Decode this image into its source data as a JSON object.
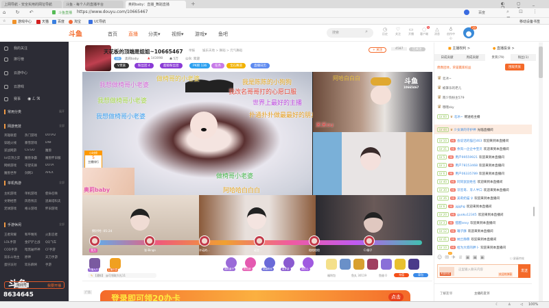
{
  "browser": {
    "tabs": [
      {
        "label": "上网导航 - 安全实用的网址导航"
      },
      {
        "label": "斗鱼 - 每个人的直播平台"
      },
      {
        "label": "奥莉baby：直播_舞蹈直播"
      }
    ],
    "site_label": "斗鱼直播",
    "url": "https://www.douyu.com/10665467",
    "search_engine": "百度",
    "bookmarks": [
      "游戏中心",
      "天猫",
      "百度",
      "淘宝",
      "UC导航"
    ],
    "mobile_bookmarks": "移动设备书签",
    "zoom": "100%"
  },
  "site": {
    "logo": "斗鱼",
    "nav": [
      "首页",
      "直播",
      "分类",
      "视频",
      "游戏",
      "鱼吧"
    ],
    "active_nav": "直播",
    "search_placeholder": "搜索",
    "icons": [
      {
        "label": "历史"
      },
      {
        "label": "关注"
      },
      {
        "label": "开播"
      },
      {
        "label": "客户端",
        "badge": "1"
      },
      {
        "label": "消息"
      },
      {
        "label": "创作中心"
      }
    ],
    "avatar_badge": "20"
  },
  "sidebar": {
    "items": [
      "我的关注",
      "排行榜",
      "云游中心",
      "云游戏",
      "赛事"
    ],
    "common": {
      "title": "常用分类",
      "more": "展开"
    },
    "sections": [
      {
        "title": "网游竞技",
        "more": "全部",
        "games": [
          "英雄联盟",
          "热门游戏",
          "DOTA2",
          "穿越火线",
          "暴雪游戏",
          "DNF",
          "逆战网游",
          "CS:GO",
          "魔兽",
          "lol云顶之弈",
          "魔兽争霸",
          "魔兽怀旧服",
          "网络游戏",
          "守望先锋",
          "DOTA",
          "魔兽世界",
          "剑网3",
          "APEX"
        ]
      },
      {
        "title": "单机热游",
        "more": "全部",
        "games": [
          "主机游戏",
          "单机游戏",
          "使命召唤",
          "文明经营",
          "风卷残云",
          "逃离塔科夫",
          "足球游戏",
          "格斗游戏",
          "怀旧游戏"
        ]
      },
      {
        "title": "手游休闲",
        "more": "全部",
        "games": [
          "王者荣耀",
          "和平精英",
          "火影忍者",
          "LOL手游",
          "金铲铲之战",
          "QQ飞车",
          "COD手游",
          "暗黑破坏神",
          "CF手游",
          "双乐斗地主",
          "原神",
          "天刀手游",
          "蛋仔派对",
          "欢乐麻将",
          "手游"
        ]
      }
    ],
    "room_label": "房间号",
    "room_number": "8634645",
    "start_stream": "我要开播"
  },
  "room": {
    "title": "天花板的顶端是姐姐~10665467",
    "report": "举报",
    "category": "娱乐天地 > 舞蹈 > 元气舞蹈",
    "anchor_level": "34",
    "anchor_name": "奥莉baby",
    "hot": "143098",
    "fans": "5万",
    "announce": "公众: 欢迎",
    "follow": "+ 关注",
    "follow_count": "4587",
    "followed": "已关注",
    "badges": [
      {
        "label": "V贵族",
        "color": "#333"
      },
      {
        "label": "粉丝团 4",
        "color": "#8a3bd6"
      },
      {
        "label": "超级粉丝团",
        "color": "#8a3bd6"
      },
      {
        "label": "PK榜 136",
        "color": "#2ea1f0"
      },
      {
        "label": "任务",
        "color": "#c77ae8"
      },
      {
        "label": "宝石赛道",
        "color": "#f2b200"
      },
      {
        "label": "直播日历",
        "color": "#5d8af0"
      }
    ],
    "hot_tag": "热度榜 1 火爆",
    "share": "分享",
    "client": "客户端"
  },
  "video": {
    "danmaku": [
      {
        "text": "做椅哥的小老婆",
        "color": "#e4c23a"
      },
      {
        "text": "我想做椅哥小老婆",
        "color": "#d86ad8"
      },
      {
        "text": "我想做椅哥小老婆",
        "color": "#a8d84a"
      },
      {
        "text": "我想做椅哥小老婆",
        "color": "#3aa0f0"
      },
      {
        "text": "我是陈陈的小狗狗",
        "color": "#e8a820"
      },
      {
        "text": "我改名哥哥打的心愿口服",
        "color": "#e84a3a"
      },
      {
        "text": "世界上最好的主播",
        "color": "#c04ae0"
      },
      {
        "text": "扑通扑扑做最最好的朋友",
        "color": "#e8a020"
      },
      {
        "text": "做椅哥小老婆",
        "color": "#4ab850"
      },
      {
        "text": "阿哈哈白白白",
        "color": "#e8a820"
      }
    ],
    "main_name": "奥莉baby",
    "rank_label": "小时榜",
    "rank_value": "5",
    "rank_sub": "主播排行",
    "tile_top_right": "阿哈白白白",
    "tile_name": "米米ou",
    "watermark": "斗鱼",
    "watermark_room": "10665467",
    "pk_players": [
      {
        "name": "我方"
      },
      {
        "name": "张-Bingo"
      },
      {
        "name": "许诺的..."
      },
      {
        "name": "诺甘..."
      },
      {
        "name": "橙橙橙橙"
      },
      {
        "name": "Cr柳子"
      }
    ],
    "timer": "倒计时: 05:24"
  },
  "gifts": {
    "left": [
      "开播大厅",
      "主播乐园"
    ],
    "mid": [
      "福利桌子",
      "粉丝团",
      "超级粉丝",
      "星梦游",
      "我的心"
    ],
    "notice": "【通知】 @可领取大礼11",
    "welfare": "福利包",
    "gold": "鱼丸 30119",
    "fish": "鱼翅 0",
    "recharge": "充值",
    "bag": "背包"
  },
  "banner": {
    "text": "登录即可领20办卡",
    "click": "点击",
    "tag": "广告"
  },
  "chat": {
    "top": [
      "主播权利 >",
      "直播投诉 >"
    ],
    "tabs": [
      "日成贡献",
      "周成贡献",
      "贵宾(79)",
      "粉丝(1)"
    ],
    "promo": "偶像团体，荣誉赢家权益",
    "promo_btn": "围观贵族",
    "vips": [
      {
        "name": "北冰~"
      },
      {
        "name": "被掌乐的老儿"
      },
      {
        "name": "南少狗扮主579"
      },
      {
        "name": "哦哦sky"
      }
    ],
    "gift_msg": {
      "level": "LV 60",
      "name": "北冰~",
      "text": "赠送给主播"
    },
    "highlight": {
      "level": "LV 44",
      "name": "少女滴的守护神",
      "text": "光临直播间"
    },
    "messages": [
      {
        "level": "LV 10",
        "name": "会说话的猫已463",
        "text": "欢迎来到本直播间"
      },
      {
        "level": "LV 31",
        "name": "余岚一企企中宝贝",
        "text": "欢迎来到本直播间"
      },
      {
        "level": "LV 5",
        "name": "用户99559921",
        "text": "欢迎来到本直播间"
      },
      {
        "level": "LV 1",
        "name": "用户78153468",
        "text": "欢迎来到本直播间"
      },
      {
        "level": "LV 6",
        "name": "用户06335789",
        "text": "欢迎来到本直播间"
      },
      {
        "level": "LV 40",
        "name": "同同鼠鼠姓名",
        "text": "欢迎来到本直播间"
      },
      {
        "level": "LV 30",
        "name": "牙签哥、牙人半口",
        "text": "欢迎来到本直播间"
      },
      {
        "level": "LV 36",
        "name": "美莉奶猫 ♀",
        "text": "欢迎来到本直播间"
      },
      {
        "level": "LV 6",
        "name": "jgjghg",
        "text": "欢迎来到本直播间"
      },
      {
        "level": "LV 20",
        "name": "guoku12345",
        "text": "欢迎来到本直播间"
      },
      {
        "level": "LV 3",
        "name": "甜甜sexy",
        "text": "欢迎来到本直播间"
      },
      {
        "level": "LV 12",
        "name": "罐子酥",
        "text": "欢迎来到本直播间"
      },
      {
        "level": "LV 41",
        "name": "纳兰静霖",
        "text": "欢迎来到本直播间"
      },
      {
        "level": "LV 10",
        "name": "给为大叔的胖卜",
        "text": "欢迎来到本直播间"
      }
    ],
    "badge_count": "20",
    "hide_effects": "屏蔽特效",
    "input_placeholder": "这里输入聊天内容",
    "barrage_tag": "欢迎的弹幕",
    "send": "发送",
    "friend_label": "了解友邻",
    "friend_value": "主播的友邻",
    "vip_tag": "贵族特权"
  }
}
